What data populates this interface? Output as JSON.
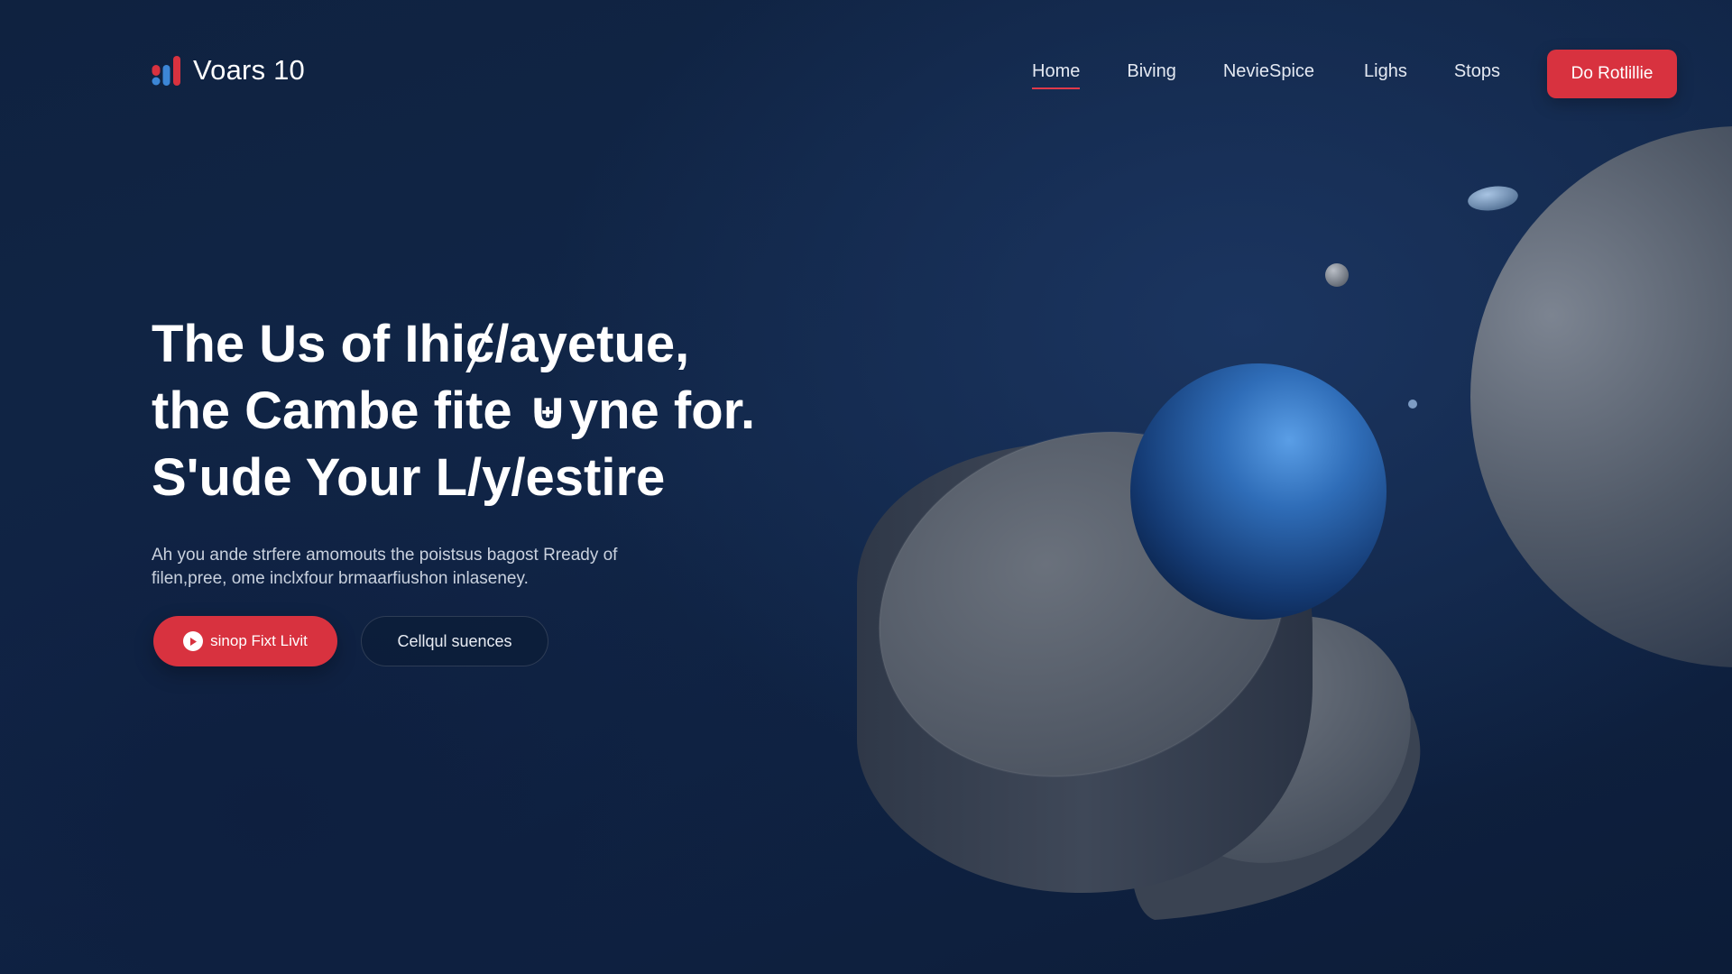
{
  "brand": {
    "name": "Voars 10",
    "colors": {
      "accent": "#d8323f",
      "blue": "#3c86d6"
    }
  },
  "nav": {
    "items": [
      {
        "label": "Home",
        "active": true
      },
      {
        "label": "Biving",
        "active": false
      },
      {
        "label": "NevieSpice",
        "active": false
      },
      {
        "label": "Lighs",
        "active": false
      },
      {
        "label": "Stops",
        "active": false
      }
    ],
    "cta_label": "Do Rotlillie"
  },
  "hero": {
    "title_lines": [
      "The Us of Ihiȼ/ayetue,",
      "the Cambe fite ⊎yne for.",
      "S'ude Your L/y/estire"
    ],
    "subtitle_lines": [
      "Ah you ande strfere amomouts the poistsus bagost Rready of",
      "filen,pree, ome inclxfour brmaarfiushon inlaseney."
    ],
    "primary_button": {
      "label": "sinop Fixt Livit",
      "icon": "play-icon"
    },
    "secondary_button": {
      "label": "Cellqul suences"
    }
  }
}
